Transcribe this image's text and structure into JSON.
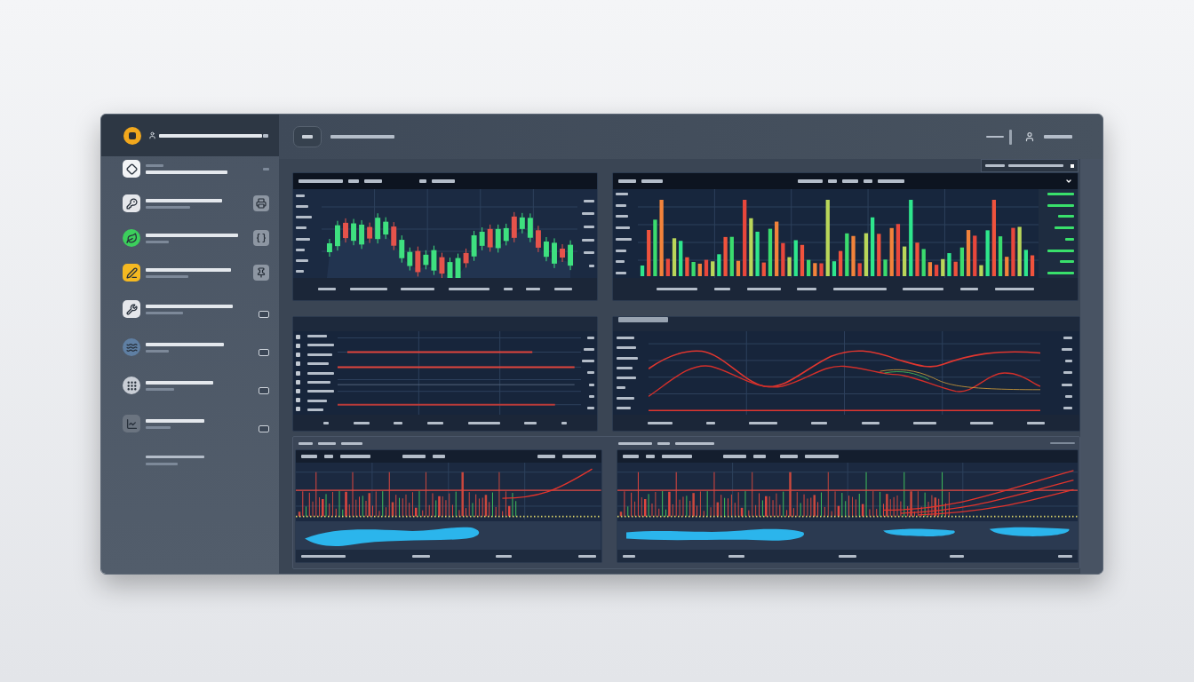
{
  "sidebar": {
    "items": [
      {
        "kind": "caption",
        "color": "#f3f4f6"
      },
      {
        "kind": "tool",
        "color": "#e5e7eb"
      },
      {
        "kind": "tool",
        "color": "#3ccf5c"
      },
      {
        "kind": "tool",
        "color": "#f5b921"
      },
      {
        "kind": "badge",
        "color": "#e5e7eb"
      },
      {
        "kind": "badge",
        "color": "#5f7fa3"
      },
      {
        "kind": "badge",
        "color": "#c9ced6"
      },
      {
        "kind": "badge",
        "color": "#6b7480"
      }
    ]
  },
  "panels": [
    {
      "kind": "candles"
    },
    {
      "kind": "bars"
    },
    {
      "kind": "levels"
    },
    {
      "kind": "curves"
    },
    {
      "kind": "spikes"
    },
    {
      "kind": "spikes"
    }
  ]
}
